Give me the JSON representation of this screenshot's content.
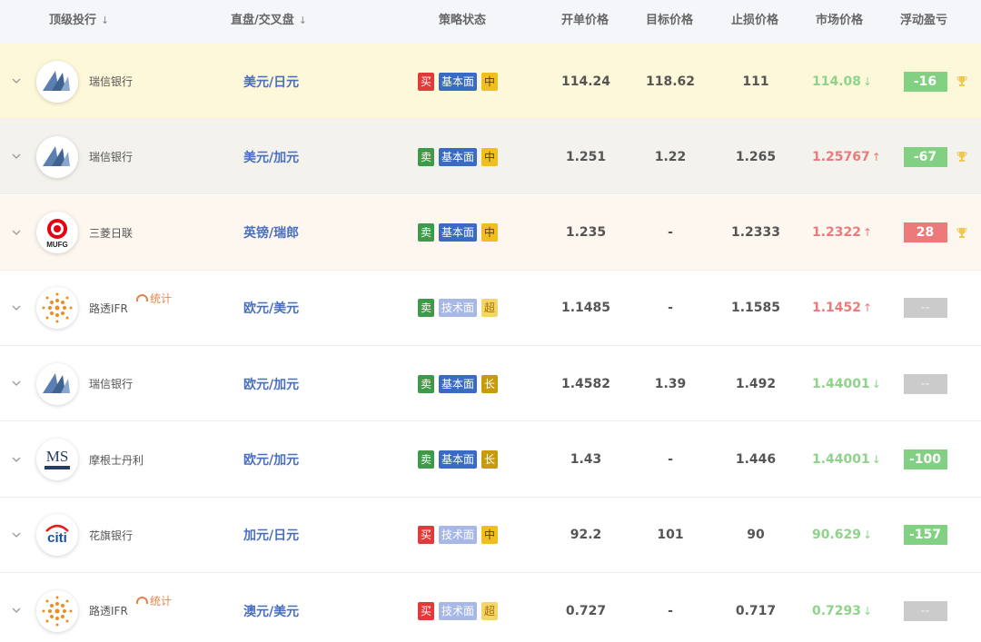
{
  "header": {
    "bank": "顶级投行",
    "pair": "直盘/交叉盘",
    "strategy": "策略状态",
    "open": "开单价格",
    "target": "目标价格",
    "stop": "止损价格",
    "market": "市场价格",
    "pnl": "浮动盈亏",
    "sort_icon": "↓"
  },
  "icons": {
    "chevron": "chevron-down-icon",
    "trophy": "trophy-icon",
    "stat": "gauge-icon"
  },
  "stat_label": "统计",
  "rows": [
    {
      "bank": "瑞信银行",
      "logo": "credit-suisse",
      "pair": "美元/日元",
      "dir": "买",
      "type": "基本面",
      "term": "中",
      "open": "114.24",
      "target": "118.62",
      "stop": "111",
      "market": "114.08",
      "trend": "down",
      "arrow": "↓",
      "pnl": "-16",
      "pnl_kind": "neg",
      "trophy": true,
      "bg": "#fdf8d9",
      "stat": false
    },
    {
      "bank": "瑞信银行",
      "logo": "credit-suisse",
      "pair": "美元/加元",
      "dir": "卖",
      "type": "基本面",
      "term": "中",
      "open": "1.251",
      "target": "1.22",
      "stop": "1.265",
      "market": "1.25767",
      "trend": "up",
      "arrow": "↑",
      "pnl": "-67",
      "pnl_kind": "neg",
      "trophy": true,
      "bg": "#f3f2ec",
      "stat": false
    },
    {
      "bank": "三菱日联",
      "logo": "mufg",
      "pair": "英镑/瑞郎",
      "dir": "卖",
      "type": "基本面",
      "term": "中",
      "open": "1.235",
      "target": "-",
      "stop": "1.2333",
      "market": "1.2322",
      "trend": "up",
      "arrow": "↑",
      "pnl": "28",
      "pnl_kind": "pos",
      "trophy": true,
      "bg": "#fdf7f0",
      "stat": false
    },
    {
      "bank": "路透IFR",
      "logo": "reuters",
      "pair": "欧元/美元",
      "dir": "卖",
      "type": "技术面",
      "term": "超",
      "open": "1.1485",
      "target": "-",
      "stop": "1.1585",
      "market": "1.1452",
      "trend": "up",
      "arrow": "↑",
      "pnl": "--",
      "pnl_kind": "none",
      "trophy": false,
      "bg": "#ffffff",
      "stat": true
    },
    {
      "bank": "瑞信银行",
      "logo": "credit-suisse",
      "pair": "欧元/加元",
      "dir": "卖",
      "type": "基本面",
      "term": "长",
      "open": "1.4582",
      "target": "1.39",
      "stop": "1.492",
      "market": "1.44001",
      "trend": "down",
      "arrow": "↓",
      "pnl": "--",
      "pnl_kind": "none",
      "trophy": false,
      "bg": "#ffffff",
      "stat": false
    },
    {
      "bank": "摩根士丹利",
      "logo": "ms",
      "pair": "欧元/加元",
      "dir": "卖",
      "type": "基本面",
      "term": "长",
      "open": "1.43",
      "target": "-",
      "stop": "1.446",
      "market": "1.44001",
      "trend": "down",
      "arrow": "↓",
      "pnl": "-100",
      "pnl_kind": "neg",
      "trophy": false,
      "bg": "#ffffff",
      "stat": false
    },
    {
      "bank": "花旗银行",
      "logo": "citi",
      "pair": "加元/日元",
      "dir": "买",
      "type": "技术面",
      "term": "中",
      "open": "92.2",
      "target": "101",
      "stop": "90",
      "market": "90.629",
      "trend": "down",
      "arrow": "↓",
      "pnl": "-157",
      "pnl_kind": "neg",
      "trophy": false,
      "bg": "#ffffff",
      "stat": false
    },
    {
      "bank": "路透IFR",
      "logo": "reuters",
      "pair": "澳元/美元",
      "dir": "买",
      "type": "技术面",
      "term": "超",
      "open": "0.727",
      "target": "-",
      "stop": "0.717",
      "market": "0.7293",
      "trend": "down",
      "arrow": "↓",
      "pnl": "--",
      "pnl_kind": "none",
      "trophy": false,
      "bg": "#ffffff",
      "stat": true
    }
  ]
}
